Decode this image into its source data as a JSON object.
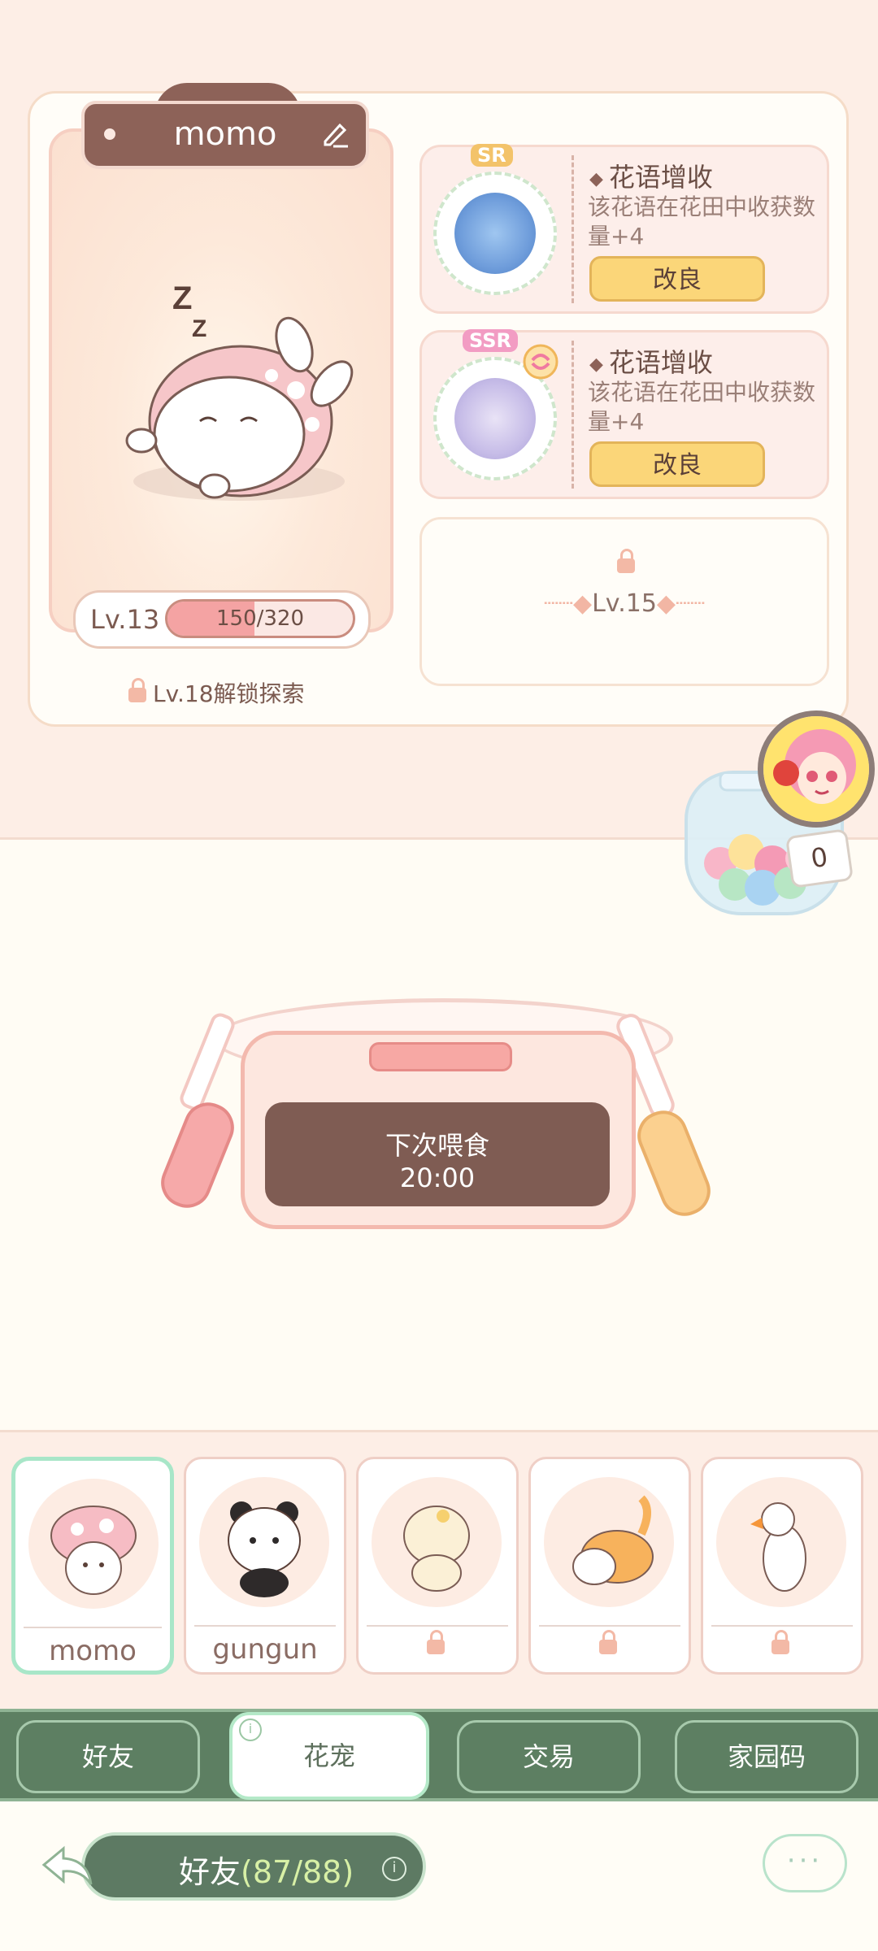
{
  "pet": {
    "name": "momo",
    "level_label": "Lv.13",
    "xp_text": "150/320",
    "xp_fraction": 0.47,
    "explore_lock_text": "Lv.18解锁探索"
  },
  "skills": [
    {
      "rarity": "SR",
      "title": "花语增收",
      "desc": "该花语在花田中收获数量+4",
      "button": "改良"
    },
    {
      "rarity": "SSR",
      "title": "花语增收",
      "desc": "该花语在花田中收获数量+4",
      "button": "改良"
    }
  ],
  "locked_skill": {
    "label": "Lv.15"
  },
  "feeding": {
    "label": "下次喂食",
    "time": "20:00"
  },
  "candy_jar": {
    "count": "0"
  },
  "pet_list": [
    {
      "name": "momo",
      "locked": false,
      "active": true
    },
    {
      "name": "gungun",
      "locked": false,
      "active": false
    },
    {
      "name": "",
      "locked": true,
      "active": false
    },
    {
      "name": "",
      "locked": true,
      "active": false
    },
    {
      "name": "",
      "locked": true,
      "active": false
    }
  ],
  "tabs": [
    {
      "label": "好友",
      "active": false
    },
    {
      "label": "花宠",
      "active": true
    },
    {
      "label": "交易",
      "active": false
    },
    {
      "label": "家园码",
      "active": false
    }
  ],
  "bottom": {
    "friends_label": "好友",
    "friends_count": "(87/88)",
    "more_label": "···"
  },
  "colors": {
    "accent_green": "#5d7f62",
    "brown": "#8d6258",
    "button_yellow": "#fbd679",
    "xp_pink": "#f4a3a3"
  }
}
